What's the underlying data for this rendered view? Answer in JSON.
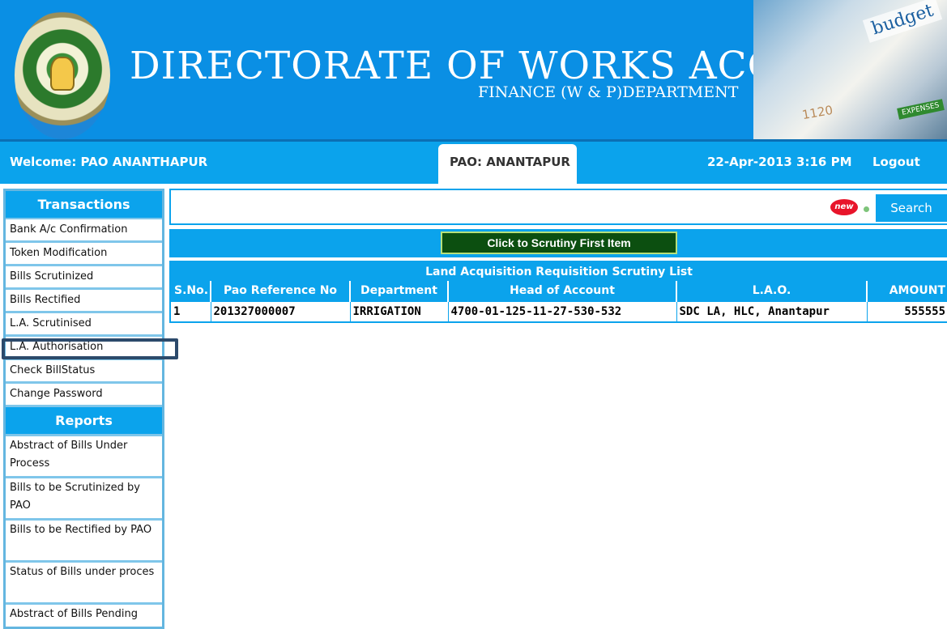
{
  "header": {
    "title": "DIRECTORATE OF WORKS ACCOUNTS",
    "subtitle": "FINANCE (W & P)DEPARTMENT",
    "graphic_word": "budget",
    "graphic_tag": "EXPENSES",
    "graphic_number": "1120"
  },
  "topbar": {
    "welcome": "Welcome: PAO ANANTHAPUR",
    "pao_tab": "PAO: ANANTAPUR",
    "datetime": "22-Apr-2013 3:16 PM",
    "logout": "Logout"
  },
  "sidebar": {
    "transactions_heading": "Transactions",
    "transactions": [
      "Bank A/c Confirmation",
      "Token Modification",
      "Bills Scrutinized",
      "Bills Rectified",
      "L.A. Scrutinised",
      "L.A. Authorisation",
      "Check BillStatus",
      "Change Password"
    ],
    "reports_heading": "Reports",
    "reports": [
      "Abstract of Bills Under Process",
      "Bills to be Scrutinized by PAO",
      "Bills to be Rectified by PAO",
      "Status of Bills under proces",
      "Abstract of Bills Pending"
    ]
  },
  "main": {
    "new_badge": "new",
    "search_label": "Search",
    "scrutiny_button": "Click to Scrutiny First Item",
    "table": {
      "caption": "Land Acquisition Requisition Scrutiny List",
      "headers": [
        "S.No.",
        "Pao Reference No",
        "Department",
        "Head of Account",
        "L.A.O.",
        "AMOUNT"
      ],
      "rows": [
        [
          "1",
          "201327000007",
          "IRRIGATION",
          "4700-01-125-11-27-530-532",
          "SDC LA, HLC, Anantapur",
          "555555"
        ]
      ]
    }
  },
  "colors": {
    "primary_blue": "#0ba3ec",
    "banner_blue": "#0a8fe4",
    "button_green": "#0c4f10",
    "highlight_border": "#2c4a6b"
  }
}
